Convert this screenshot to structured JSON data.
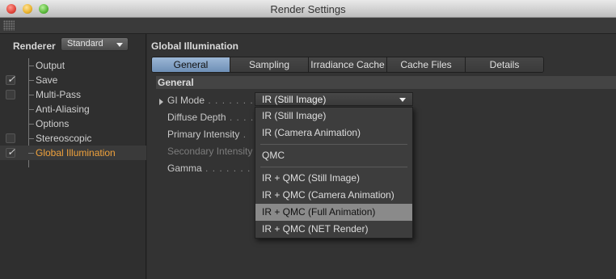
{
  "window": {
    "title": "Render Settings"
  },
  "renderer": {
    "label": "Renderer",
    "selected": "Standard"
  },
  "tree": {
    "items": [
      {
        "label": "Output",
        "checkbox": false,
        "checked": false
      },
      {
        "label": "Save",
        "checkbox": true,
        "checked": true
      },
      {
        "label": "Multi-Pass",
        "checkbox": true,
        "checked": false
      },
      {
        "label": "Anti-Aliasing",
        "checkbox": false,
        "checked": false
      },
      {
        "label": "Options",
        "checkbox": false,
        "checked": false
      },
      {
        "label": "Stereoscopic",
        "checkbox": true,
        "checked": false
      },
      {
        "label": "Global Illumination",
        "checkbox": true,
        "checked": true,
        "active": true
      }
    ]
  },
  "main": {
    "section_title": "Global Illumination",
    "tabs": [
      "General",
      "Sampling",
      "Irradiance Cache",
      "Cache Files",
      "Details"
    ],
    "active_tab": "General",
    "sub_header": "General",
    "fields": {
      "gi_mode": "GI Mode",
      "diffuse_depth": "Diffuse Depth",
      "primary_intensity": "Primary Intensity",
      "secondary_intensity": "Secondary Intensity",
      "gamma": "Gamma"
    },
    "gi_mode_value": "IR (Still Image)",
    "dropdown": {
      "options": [
        "IR (Still Image)",
        "IR (Camera Animation)",
        "QMC",
        "IR + QMC (Still Image)",
        "IR + QMC (Camera Animation)",
        "IR + QMC (Full Animation)",
        "IR + QMC (NET Render)"
      ],
      "highlighted": "IR + QMC (Full Animation)"
    }
  },
  "colors": {
    "accent": "#f0a23c",
    "tab_active": "#7f9fc4",
    "highlight": "#8a8a8a"
  }
}
